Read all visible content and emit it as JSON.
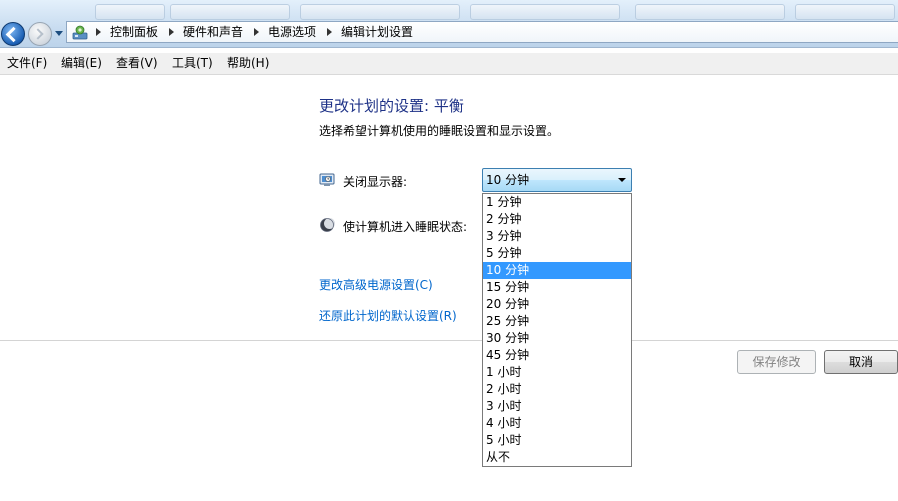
{
  "breadcrumb": {
    "items": [
      "控制面板",
      "硬件和声音",
      "电源选项",
      "编辑计划设置"
    ]
  },
  "menu": {
    "items": [
      "文件(F)",
      "编辑(E)",
      "查看(V)",
      "工具(T)",
      "帮助(H)"
    ]
  },
  "main": {
    "title": "更改计划的设置: 平衡",
    "subtitle": "选择希望计算机使用的睡眠设置和显示设置。",
    "settings": {
      "display_label": "关闭显示器:",
      "sleep_label": "使计算机进入睡眠状态:"
    },
    "dropdown": {
      "selected": "10 分钟",
      "options": [
        "1 分钟",
        "2 分钟",
        "3 分钟",
        "5 分钟",
        "10 分钟",
        "15 分钟",
        "20 分钟",
        "25 分钟",
        "30 分钟",
        "45 分钟",
        "1 小时",
        "2 小时",
        "3 小时",
        "4 小时",
        "5 小时",
        "从不"
      ],
      "highlighted_option": "10 分钟"
    },
    "links": {
      "advanced": "更改高级电源设置(C)",
      "restore": "还原此计划的默认设置(R)"
    },
    "buttons": {
      "save": "保存修改",
      "cancel": "取消"
    }
  },
  "colors": {
    "title": "#1e3287",
    "link": "#0066cc",
    "selection": "#3399ff"
  }
}
